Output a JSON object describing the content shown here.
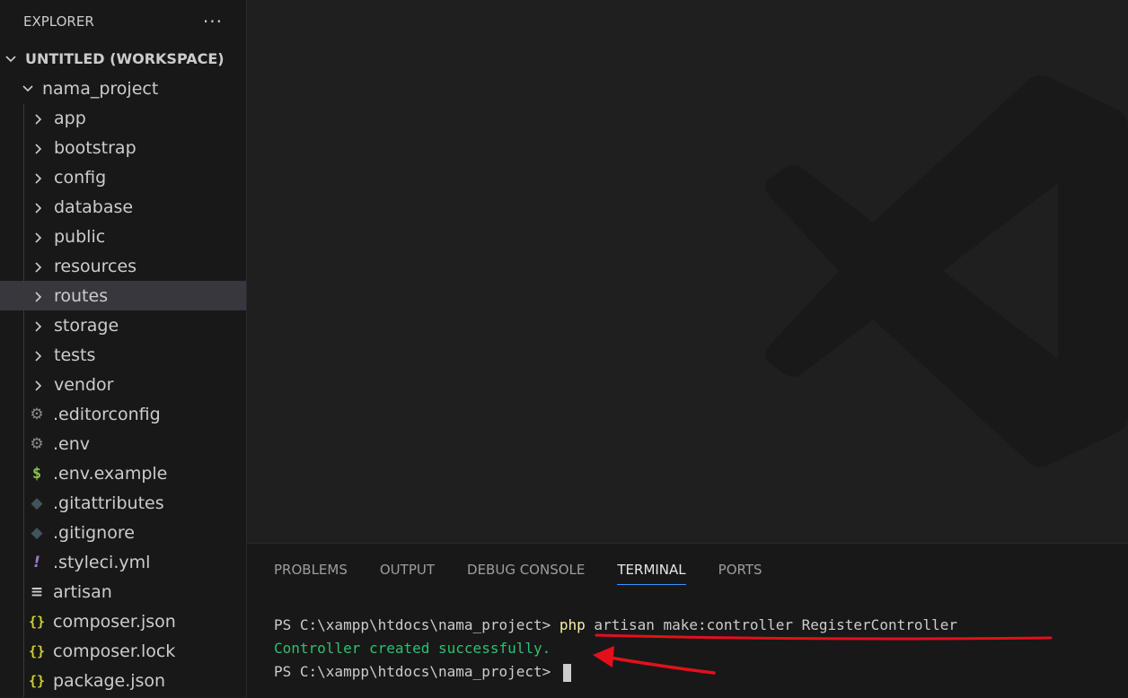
{
  "sidebar": {
    "title": "EXPLORER",
    "more_label": "···",
    "workspace": "UNTITLED (WORKSPACE)",
    "project": "nama_project",
    "folders": [
      "app",
      "bootstrap",
      "config",
      "database",
      "public",
      "resources",
      "routes",
      "storage",
      "tests",
      "vendor"
    ],
    "selected_folder": "routes",
    "files": [
      {
        "name": ".editorconfig",
        "icon": "gear-icon"
      },
      {
        "name": ".env",
        "icon": "gear-icon"
      },
      {
        "name": ".env.example",
        "icon": "dollar-icon"
      },
      {
        "name": ".gitattributes",
        "icon": "git-icon"
      },
      {
        "name": ".gitignore",
        "icon": "git-icon"
      },
      {
        "name": ".styleci.yml",
        "icon": "exclamation-icon"
      },
      {
        "name": "artisan",
        "icon": "lines-icon"
      },
      {
        "name": "composer.json",
        "icon": "braces-icon"
      },
      {
        "name": "composer.lock",
        "icon": "braces-icon"
      },
      {
        "name": "package.json",
        "icon": "braces-icon"
      }
    ]
  },
  "panel": {
    "tabs": [
      "PROBLEMS",
      "OUTPUT",
      "DEBUG CONSOLE",
      "TERMINAL",
      "PORTS"
    ],
    "active_tab": "TERMINAL"
  },
  "terminal": {
    "prompt": "PS C:\\xampp\\htdocs\\nama_project> ",
    "command_bin": "php",
    "command_rest": " artisan make:controller RegisterController",
    "output": "Controller created successfully."
  },
  "colors": {
    "annotation": "#e3101b",
    "success": "#2fbf71",
    "tab_active_border": "#3794ff"
  }
}
